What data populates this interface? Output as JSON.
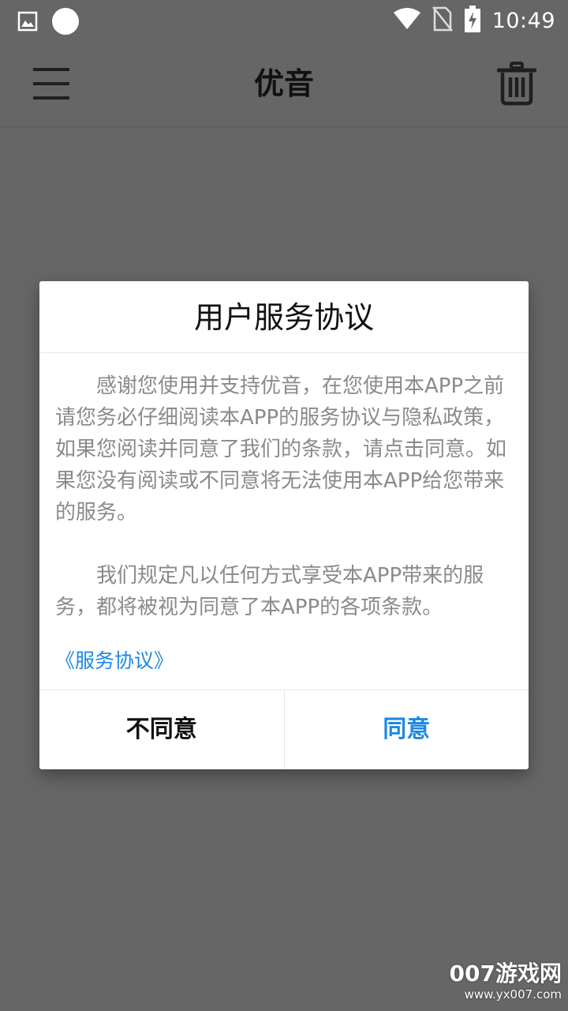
{
  "status_bar": {
    "time": "10:49",
    "icons": [
      "image-icon",
      "circle-icon",
      "wifi-icon",
      "no-sim-icon",
      "battery-charging-icon"
    ]
  },
  "app_bar": {
    "title": "优音",
    "menu_icon": "hamburger-menu-icon",
    "trash_icon": "trash-icon"
  },
  "dialog": {
    "title": "用户服务协议",
    "paragraph1": "感谢您使用并支持优音，在您使用本APP之前请您务必仔细阅读本APP的服务协议与隐私政策，如果您阅读并同意了我们的条款，请点击同意。如果您没有阅读或不同意将无法使用本APP给您带来的服务。",
    "paragraph2": "我们规定凡以任何方式享受本APP带来的服务，都将被视为同意了本APP的各项条款。",
    "link_text": "《服务协议》",
    "disagree_label": "不同意",
    "agree_label": "同意"
  },
  "watermark": {
    "main": "007游戏网",
    "url": "www.yx007.com"
  },
  "colors": {
    "background": "#666666",
    "dialog_bg": "#ffffff",
    "accent": "#1e88e5",
    "body_text": "#8a8a8a"
  }
}
